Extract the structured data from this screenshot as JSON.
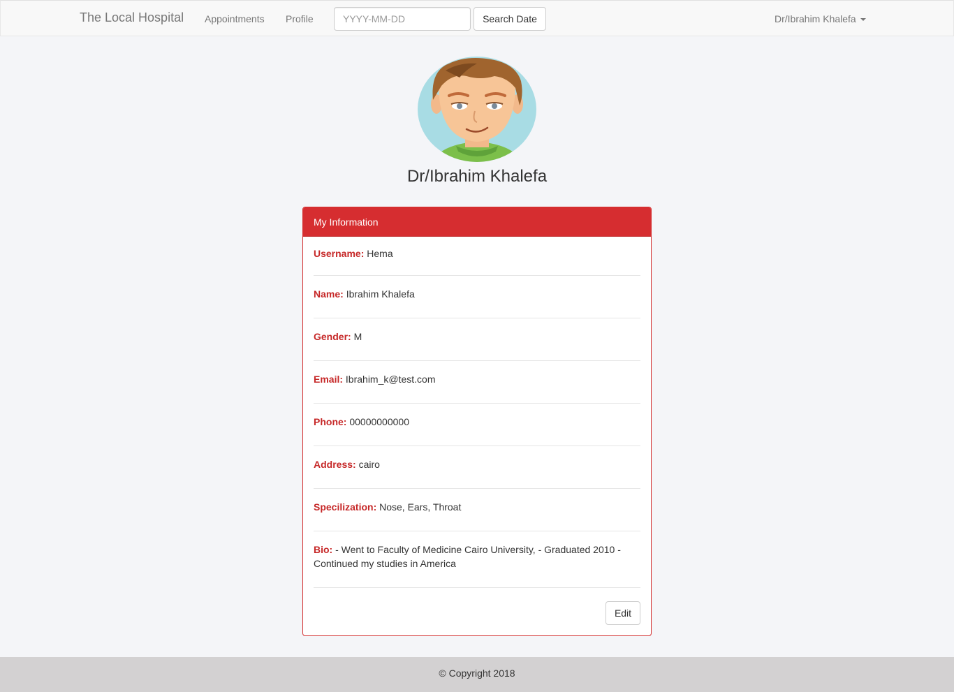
{
  "navbar": {
    "brand": "The Local Hospital",
    "links": [
      "Appointments",
      "Profile"
    ],
    "date_placeholder": "YYYY-MM-DD",
    "search_label": "Search Date",
    "user_label": "Dr/Ibrahim Khalefa"
  },
  "profile": {
    "avatar_icon": "doctor-avatar-icon",
    "display_name": "Dr/Ibrahim Khalefa"
  },
  "panel": {
    "title": "My Information",
    "fields": [
      {
        "label": "Username:",
        "value": "Hema"
      },
      {
        "label": "Name:",
        "value": "Ibrahim Khalefa"
      },
      {
        "label": "Gender:",
        "value": "M"
      },
      {
        "label": "Email:",
        "value": "Ibrahim_k@test.com"
      },
      {
        "label": "Phone:",
        "value": "00000000000"
      },
      {
        "label": "Address:",
        "value": "cairo"
      },
      {
        "label": "Specilization:",
        "value": "Nose, Ears, Throat"
      },
      {
        "label": "Bio:",
        "value": "- Went to Faculty of Medicine Cairo University, - Graduated 2010 - Continued my studies in America"
      }
    ],
    "edit_label": "Edit"
  },
  "footer": {
    "text": "© Copyright 2018"
  },
  "colors": {
    "accent": "#d62d30",
    "label": "#c62828",
    "footer_bg": "#d3d1d2",
    "page_bg": "#f4f5f8"
  }
}
